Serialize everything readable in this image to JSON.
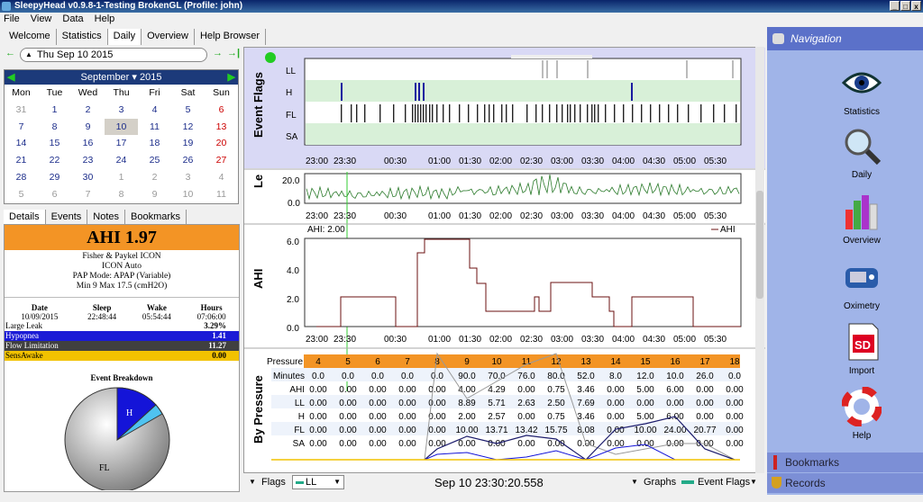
{
  "window": {
    "title": "SleepyHead v0.9.8-1-Testing BrokenGL (Profile: john)"
  },
  "menu": [
    "File",
    "View",
    "Data",
    "Help"
  ],
  "tabs": [
    "Welcome",
    "Statistics",
    "Daily",
    "Overview",
    "Help Browser"
  ],
  "date": {
    "value": "Thu Sep 10 2015"
  },
  "calendar": {
    "month": "September",
    "year": "2015",
    "weekdays": [
      "Mon",
      "Tue",
      "Wed",
      "Thu",
      "Fri",
      "Sat",
      "Sun"
    ],
    "days": [
      [
        "31",
        "1",
        "2",
        "3",
        "4",
        "5",
        "6"
      ],
      [
        "7",
        "8",
        "9",
        "10",
        "11",
        "12",
        "13"
      ],
      [
        "14",
        "15",
        "16",
        "17",
        "18",
        "19",
        "20"
      ],
      [
        "21",
        "22",
        "23",
        "24",
        "25",
        "26",
        "27"
      ],
      [
        "28",
        "29",
        "30",
        "1",
        "2",
        "3",
        "4"
      ],
      [
        "5",
        "6",
        "7",
        "8",
        "9",
        "10",
        "11"
      ]
    ]
  },
  "left_tabs": [
    "Details",
    "Events",
    "Notes",
    "Bookmarks"
  ],
  "details": {
    "ahi": "AHI 1.97",
    "machine": [
      "Fisher & Paykel ICON",
      "ICON Auto",
      "PAP Mode: APAP (Variable)",
      "Min 9 Max 17.5 (cmH2O)"
    ],
    "cols": [
      "Date",
      "Sleep",
      "Wake",
      "Hours"
    ],
    "row": [
      "10/09/2015",
      "22:48:44",
      "05:54:44",
      "07:06:00"
    ],
    "events": [
      {
        "name": "Large Leak",
        "value": "3.29%",
        "color": "#ffffff"
      },
      {
        "name": "Hypopnea",
        "value": "1.41",
        "color": "#1b1bd6"
      },
      {
        "name": "Flow Limitation",
        "value": "11.27",
        "color": "#404040"
      },
      {
        "name": "SensAwake",
        "value": "0.00",
        "color": "#f2c200"
      }
    ],
    "breakdown_title": "Event Breakdown",
    "pie_labels": [
      "H",
      "FL"
    ]
  },
  "graphs": {
    "event_flags": {
      "title": "Event Flags",
      "rows": [
        "LL",
        "H",
        "FL",
        "SA"
      ]
    },
    "time_ticks": [
      "23:00",
      "23:30",
      "00:30",
      "01:00",
      "01:30",
      "02:00",
      "02:30",
      "03:00",
      "03:30",
      "04:00",
      "04:30",
      "05:00",
      "05:30"
    ],
    "leak": {
      "title": "Le",
      "yticks": [
        "20.0",
        "0.0"
      ]
    },
    "ahi": {
      "title": "AHI",
      "legend": "AHI",
      "label": "AHI: 2.00",
      "yticks": [
        "6.0",
        "4.0",
        "2.0",
        "0.0"
      ]
    },
    "pressure": {
      "title": "By Pressure",
      "header": [
        "Pressure",
        "4",
        "5",
        "6",
        "7",
        "8",
        "9",
        "10",
        "11",
        "12",
        "13",
        "14",
        "15",
        "16",
        "17",
        "18"
      ],
      "rows": [
        [
          "Minutes",
          "0.0",
          "0.0",
          "0.0",
          "0.0",
          "0.0",
          "90.0",
          "70.0",
          "76.0",
          "80.0",
          "52.0",
          "8.0",
          "12.0",
          "10.0",
          "26.0",
          "0.0"
        ],
        [
          "AHI",
          "0.00",
          "0.00",
          "0.00",
          "0.00",
          "0.00",
          "4.00",
          "4.29",
          "0.00",
          "0.75",
          "3.46",
          "0.00",
          "5.00",
          "6.00",
          "0.00",
          "0.00"
        ],
        [
          "LL",
          "0.00",
          "0.00",
          "0.00",
          "0.00",
          "0.00",
          "8.89",
          "5.71",
          "2.63",
          "2.50",
          "7.69",
          "0.00",
          "0.00",
          "0.00",
          "0.00",
          "0.00"
        ],
        [
          "H",
          "0.00",
          "0.00",
          "0.00",
          "0.00",
          "0.00",
          "2.00",
          "2.57",
          "0.00",
          "0.75",
          "3.46",
          "0.00",
          "5.00",
          "6.00",
          "0.00",
          "0.00"
        ],
        [
          "FL",
          "0.00",
          "0.00",
          "0.00",
          "0.00",
          "0.00",
          "10.00",
          "13.71",
          "13.42",
          "15.75",
          "8.08",
          "0.00",
          "10.00",
          "24.00",
          "20.77",
          "0.00"
        ],
        [
          "SA",
          "0.00",
          "0.00",
          "0.00",
          "0.00",
          "0.00",
          "0.00",
          "0.00",
          "0.00",
          "0.00",
          "0.00",
          "0.00",
          "0.00",
          "0.00",
          "0.00",
          "0.00"
        ]
      ]
    }
  },
  "bottom": {
    "flags": "Flags",
    "ll": "LL",
    "timestamp": "Sep 10 23:30:20.558",
    "graphs": "Graphs",
    "eventflags": "Event Flags"
  },
  "nav": {
    "title": "Navigation",
    "items": [
      "Statistics",
      "Daily",
      "Overview",
      "Oximetry",
      "Import",
      "Help"
    ],
    "bookmarks": "Bookmarks",
    "records": "Records"
  }
}
